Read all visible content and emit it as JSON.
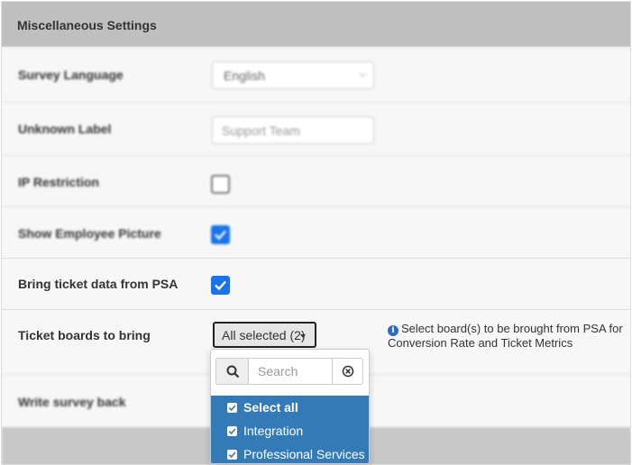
{
  "panel": {
    "title": "Miscellaneous Settings"
  },
  "rows": {
    "survey_language": {
      "label": "Survey Language",
      "value": "English"
    },
    "unknown_label": {
      "label": "Unknown Label",
      "value": "Support Team"
    },
    "ip_restriction": {
      "label": "IP Restriction",
      "checked": false
    },
    "show_employee_picture": {
      "label": "Show Employee Picture",
      "checked": true
    },
    "bring_ticket_data": {
      "label": "Bring ticket data from PSA",
      "checked": true
    },
    "ticket_boards": {
      "label": "Ticket boards to bring",
      "button_label": "All selected (2)",
      "help_text": "Select board(s) to be brought from PSA for Conversion Rate and Ticket Metrics",
      "help_icon": "info-icon"
    },
    "write_survey_back": {
      "label": "Write survey back"
    }
  },
  "dropdown": {
    "search_placeholder": "Search",
    "search_icon": "search-icon",
    "clear_icon": "clear-circle-icon",
    "options": [
      {
        "label": "Select all",
        "checked": true
      },
      {
        "label": "Integration",
        "checked": true
      },
      {
        "label": "Professional Services",
        "checked": true
      }
    ]
  },
  "colors": {
    "header_bg": "#bfbfbf",
    "checkbox_on": "#1a73e8",
    "option_highlight": "#337ab7",
    "info_icon": "#2a6ebb"
  }
}
